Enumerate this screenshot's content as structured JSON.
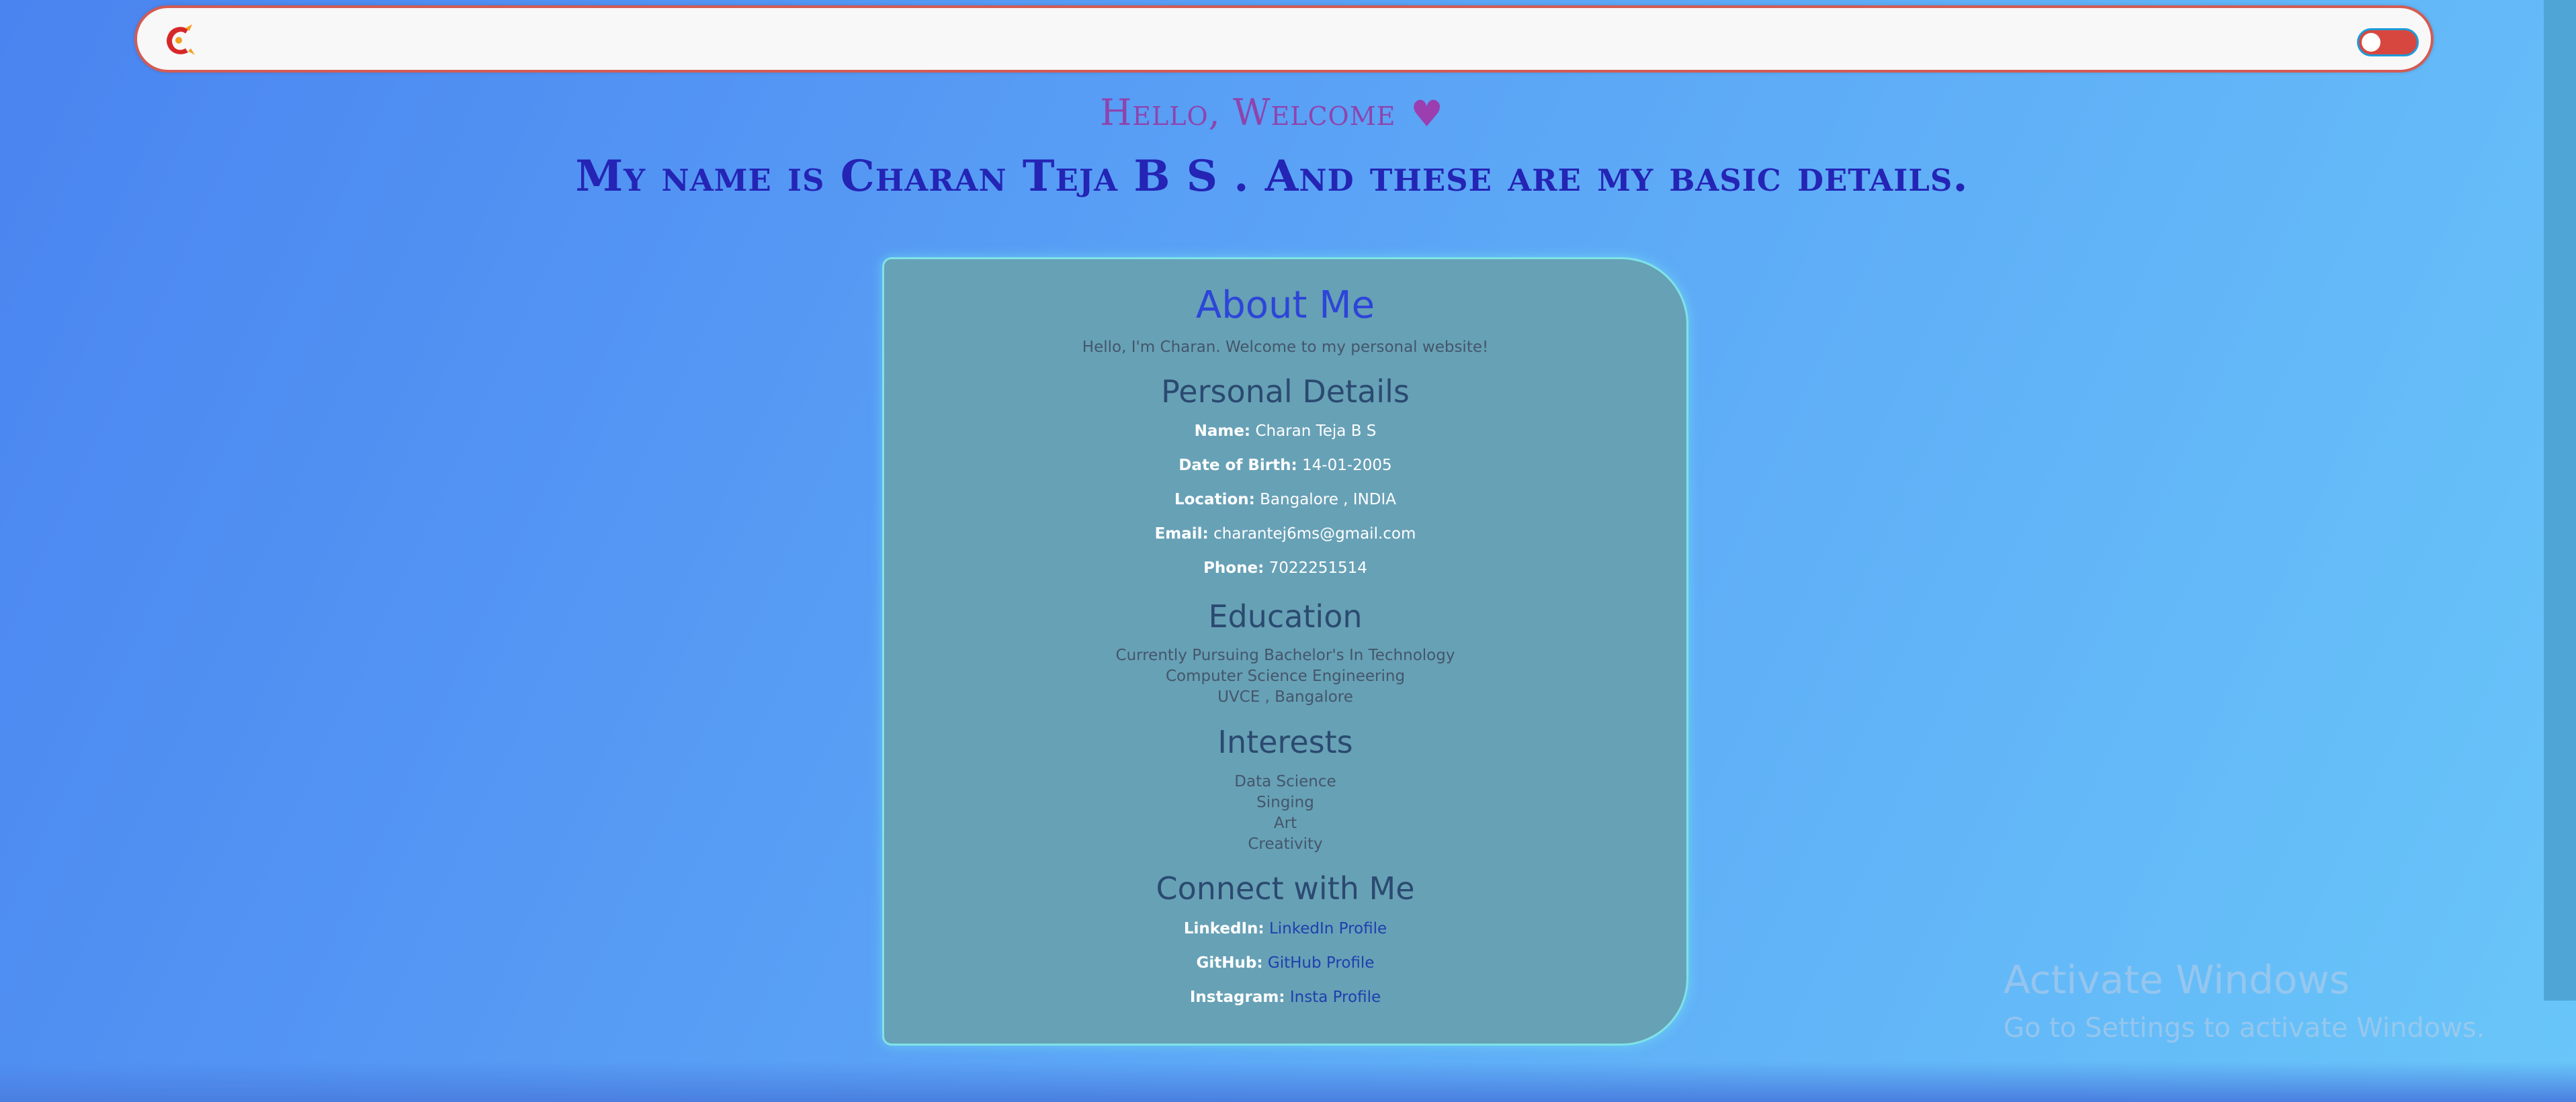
{
  "header": {
    "greeting": "Hello, Welcome",
    "heart_icon": "♥",
    "intro": "My name is Charan Teja B S . And these are my basic details."
  },
  "navbar": {
    "logo_icon": "logo-icon",
    "theme_toggle_icon": "toggle-icon"
  },
  "card": {
    "about_title": "About Me",
    "about_text": "Hello, I'm Charan. Welcome to my personal website!",
    "personal_title": "Personal Details",
    "personal": [
      {
        "label": "Name:",
        "value": "Charan Teja B S"
      },
      {
        "label": "Date of Birth:",
        "value": "14-01-2005"
      },
      {
        "label": "Location:",
        "value": "Bangalore , INDIA"
      },
      {
        "label": "Email:",
        "value": "charantej6ms@gmail.com"
      },
      {
        "label": "Phone:",
        "value": "7022251514"
      }
    ],
    "education_title": "Education",
    "education": [
      "Currently Pursuing Bachelor's In Technology",
      "Computer Science Engineering",
      "UVCE , Bangalore"
    ],
    "interests_title": "Interests",
    "interests": [
      "Data Science",
      "Singing",
      "Art",
      "Creativity"
    ],
    "connect_title": "Connect with Me",
    "connect": [
      {
        "label": "LinkedIn:",
        "value": "LinkedIn Profile"
      },
      {
        "label": "GitHub:",
        "value": "GitHub Profile"
      },
      {
        "label": "Instagram:",
        "value": "Insta Profile"
      }
    ]
  },
  "watermark": {
    "line1": "Activate Windows",
    "line2": "Go to Settings to activate Windows."
  },
  "colors": {
    "greeting": "#8e44ad",
    "intro": "#2424b5",
    "card_bg": "#67a1b6",
    "card_border": "#7fe3e6",
    "toggle": "#d8473f"
  }
}
